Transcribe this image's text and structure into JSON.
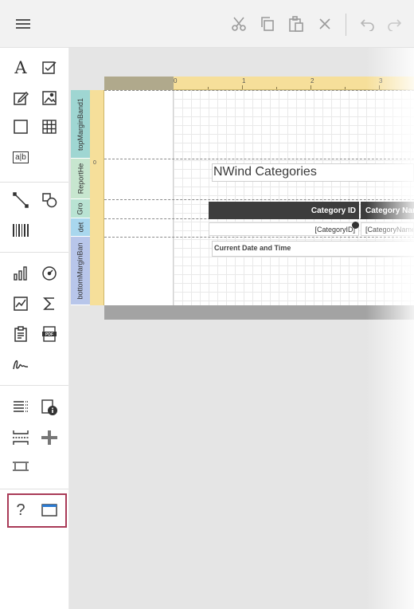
{
  "toolbar": {
    "menu_icon": "hamburger-menu-icon",
    "actions": [
      {
        "name": "cut",
        "icon": "scissors-icon"
      },
      {
        "name": "copy",
        "icon": "copy-icon"
      },
      {
        "name": "paste",
        "icon": "clipboard-icon"
      },
      {
        "name": "delete",
        "icon": "close-icon"
      },
      {
        "name": "undo",
        "icon": "undo-icon"
      },
      {
        "name": "redo",
        "icon": "redo-icon"
      }
    ]
  },
  "toolbox": {
    "text_items": {
      "label_tool": "A",
      "richtext_tool": "a|b",
      "help_tool": "?"
    },
    "highlight_color": "#a93a57"
  },
  "designer": {
    "ruler_numbers": [
      "0",
      "1",
      "2",
      "3"
    ],
    "bands": [
      {
        "label": "topMarginBand1",
        "color": "#9fd6d2"
      },
      {
        "label": "ReportHe",
        "color": "#c7e6cf"
      },
      {
        "label": "Gro",
        "color": "#b9e3d3"
      },
      {
        "label": "det",
        "color": "#a9d7ee"
      },
      {
        "label": "bottomMarginBan",
        "color": "#b8c6ea"
      }
    ],
    "report_title": "NWind Categories",
    "group_header": {
      "col1": "Category ID",
      "col2": "Category Name"
    },
    "detail": {
      "col1": "[CategoryID]",
      "col2": "[CategoryName]"
    },
    "footer_text": "Current Date and Time"
  }
}
